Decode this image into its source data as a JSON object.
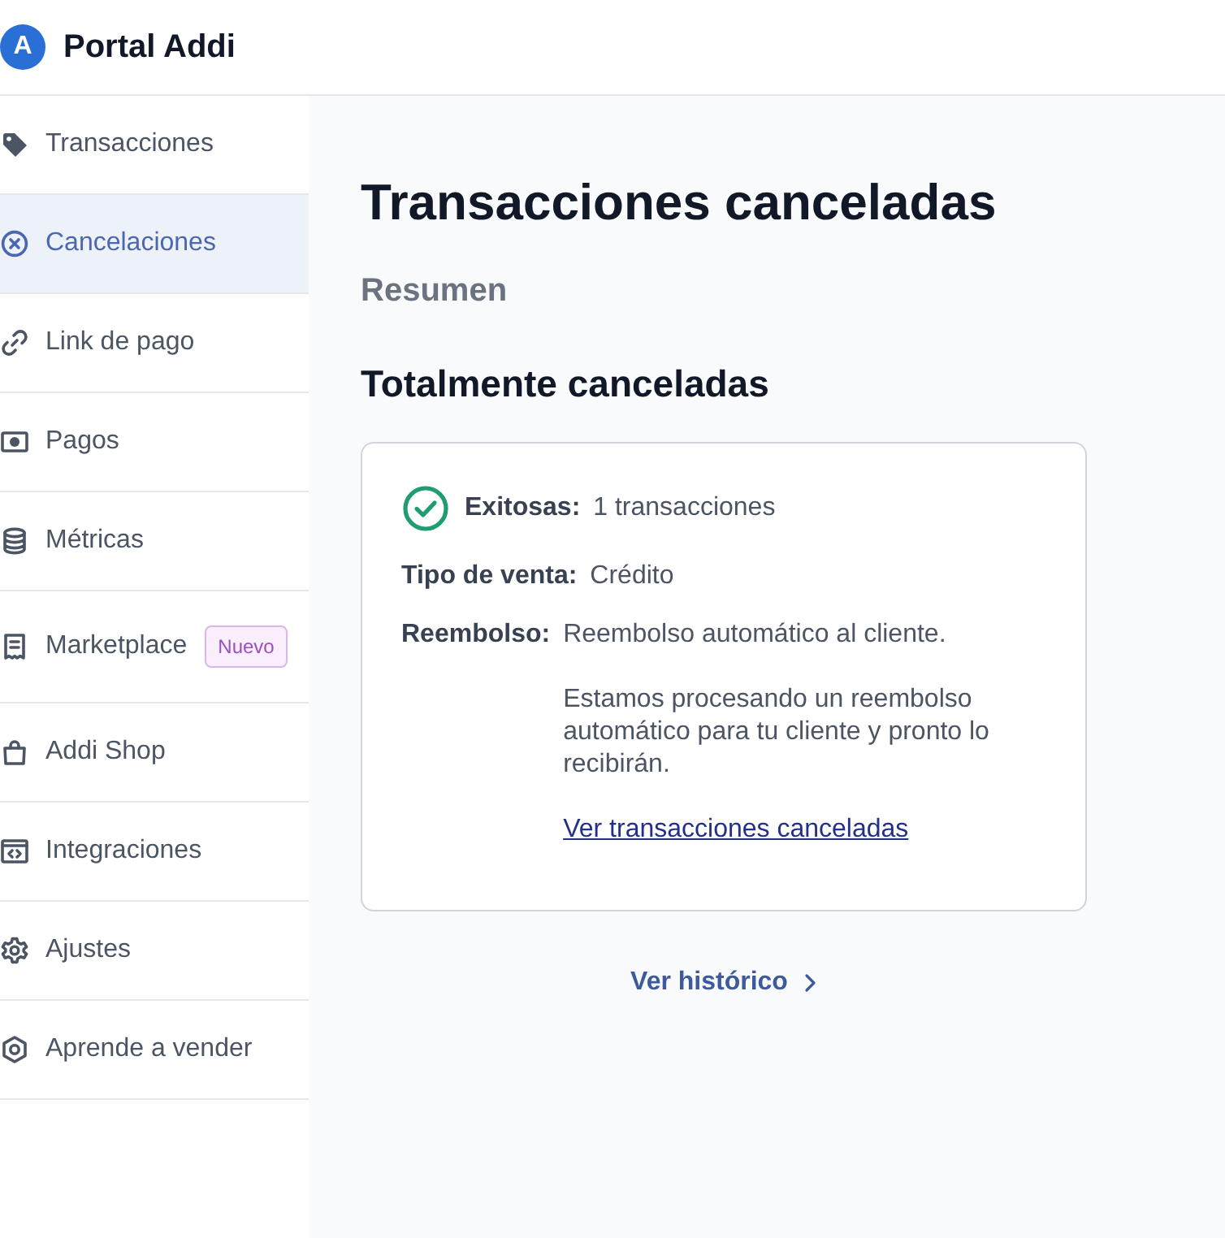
{
  "header": {
    "logo_letter": "A",
    "title": "Portal Addi"
  },
  "sidebar": {
    "items": [
      {
        "label": "Transacciones",
        "selected": false
      },
      {
        "label": "Cancelaciones",
        "selected": true
      },
      {
        "label": "Link de pago",
        "selected": false
      },
      {
        "label": "Pagos",
        "selected": false
      },
      {
        "label": "Métricas",
        "selected": false
      },
      {
        "label": "Marketplace",
        "selected": false,
        "badge": "Nuevo"
      },
      {
        "label": "Addi Shop",
        "selected": false
      },
      {
        "label": "Integraciones",
        "selected": false
      },
      {
        "label": "Ajustes",
        "selected": false
      },
      {
        "label": "Aprende a vender",
        "selected": false
      }
    ]
  },
  "page": {
    "title": "Transacciones canceladas",
    "subtitle": "Resumen",
    "section_title": "Totalmente canceladas"
  },
  "card": {
    "rows": [
      {
        "kind": "status",
        "label": "Exitosas:",
        "value": "1 transacciones"
      },
      {
        "kind": "plain",
        "label": "Tipo de venta:",
        "value": "Crédito"
      },
      {
        "kind": "detail",
        "label": "Reembolso:",
        "value": "Reembolso automático al cliente.",
        "note": "Estamos procesando un reembolso automático para tu cliente y pronto lo recibirán.",
        "link": "Ver transacciones canceladas"
      }
    ]
  },
  "history_link": {
    "label": "Ver histórico"
  }
}
